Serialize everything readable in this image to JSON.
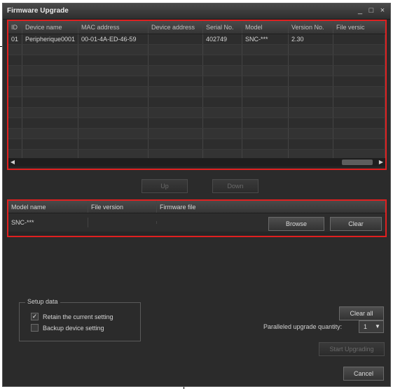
{
  "window": {
    "title": "Firmware Upgrade",
    "controls": [
      "_",
      "□",
      "×"
    ]
  },
  "device_table": {
    "columns": [
      "ID",
      "Device name",
      "MAC address",
      "Device address",
      "Serial No.",
      "Model",
      "Version No.",
      "File versic"
    ],
    "rows": [
      [
        "01",
        "Peripherique0001",
        "00-01-4A-ED-46-59",
        "",
        "402749",
        "SNC-***",
        "2.30",
        ""
      ]
    ],
    "empty_rows": 11
  },
  "move_buttons": {
    "up": "Up",
    "down": "Down"
  },
  "firmware_table": {
    "columns": [
      "Model name",
      "File version",
      "Firmware file"
    ],
    "row": {
      "model": "SNC-***",
      "file_version": "",
      "firmware_file": ""
    },
    "browse_label": "Browse",
    "clear_label": "Clear"
  },
  "setup_data": {
    "legend": "Setup data",
    "retain_label": "Retain the current setting",
    "retain_checked": true,
    "backup_label": "Backup device setting",
    "backup_checked": false
  },
  "actions": {
    "clear_all": "Clear all",
    "parallel_label": "Paralleled upgrade quantity:",
    "parallel_value": "1",
    "start_upgrading": "Start Upgrading",
    "cancel": "Cancel"
  },
  "colors": {
    "highlight": "#e02020",
    "background": "#2b2b2b"
  },
  "icons": {
    "scroll_left": "left-arrow-icon",
    "scroll_right": "right-arrow-icon",
    "dropdown": "chevron-down-icon",
    "check": "checkmark-icon"
  }
}
